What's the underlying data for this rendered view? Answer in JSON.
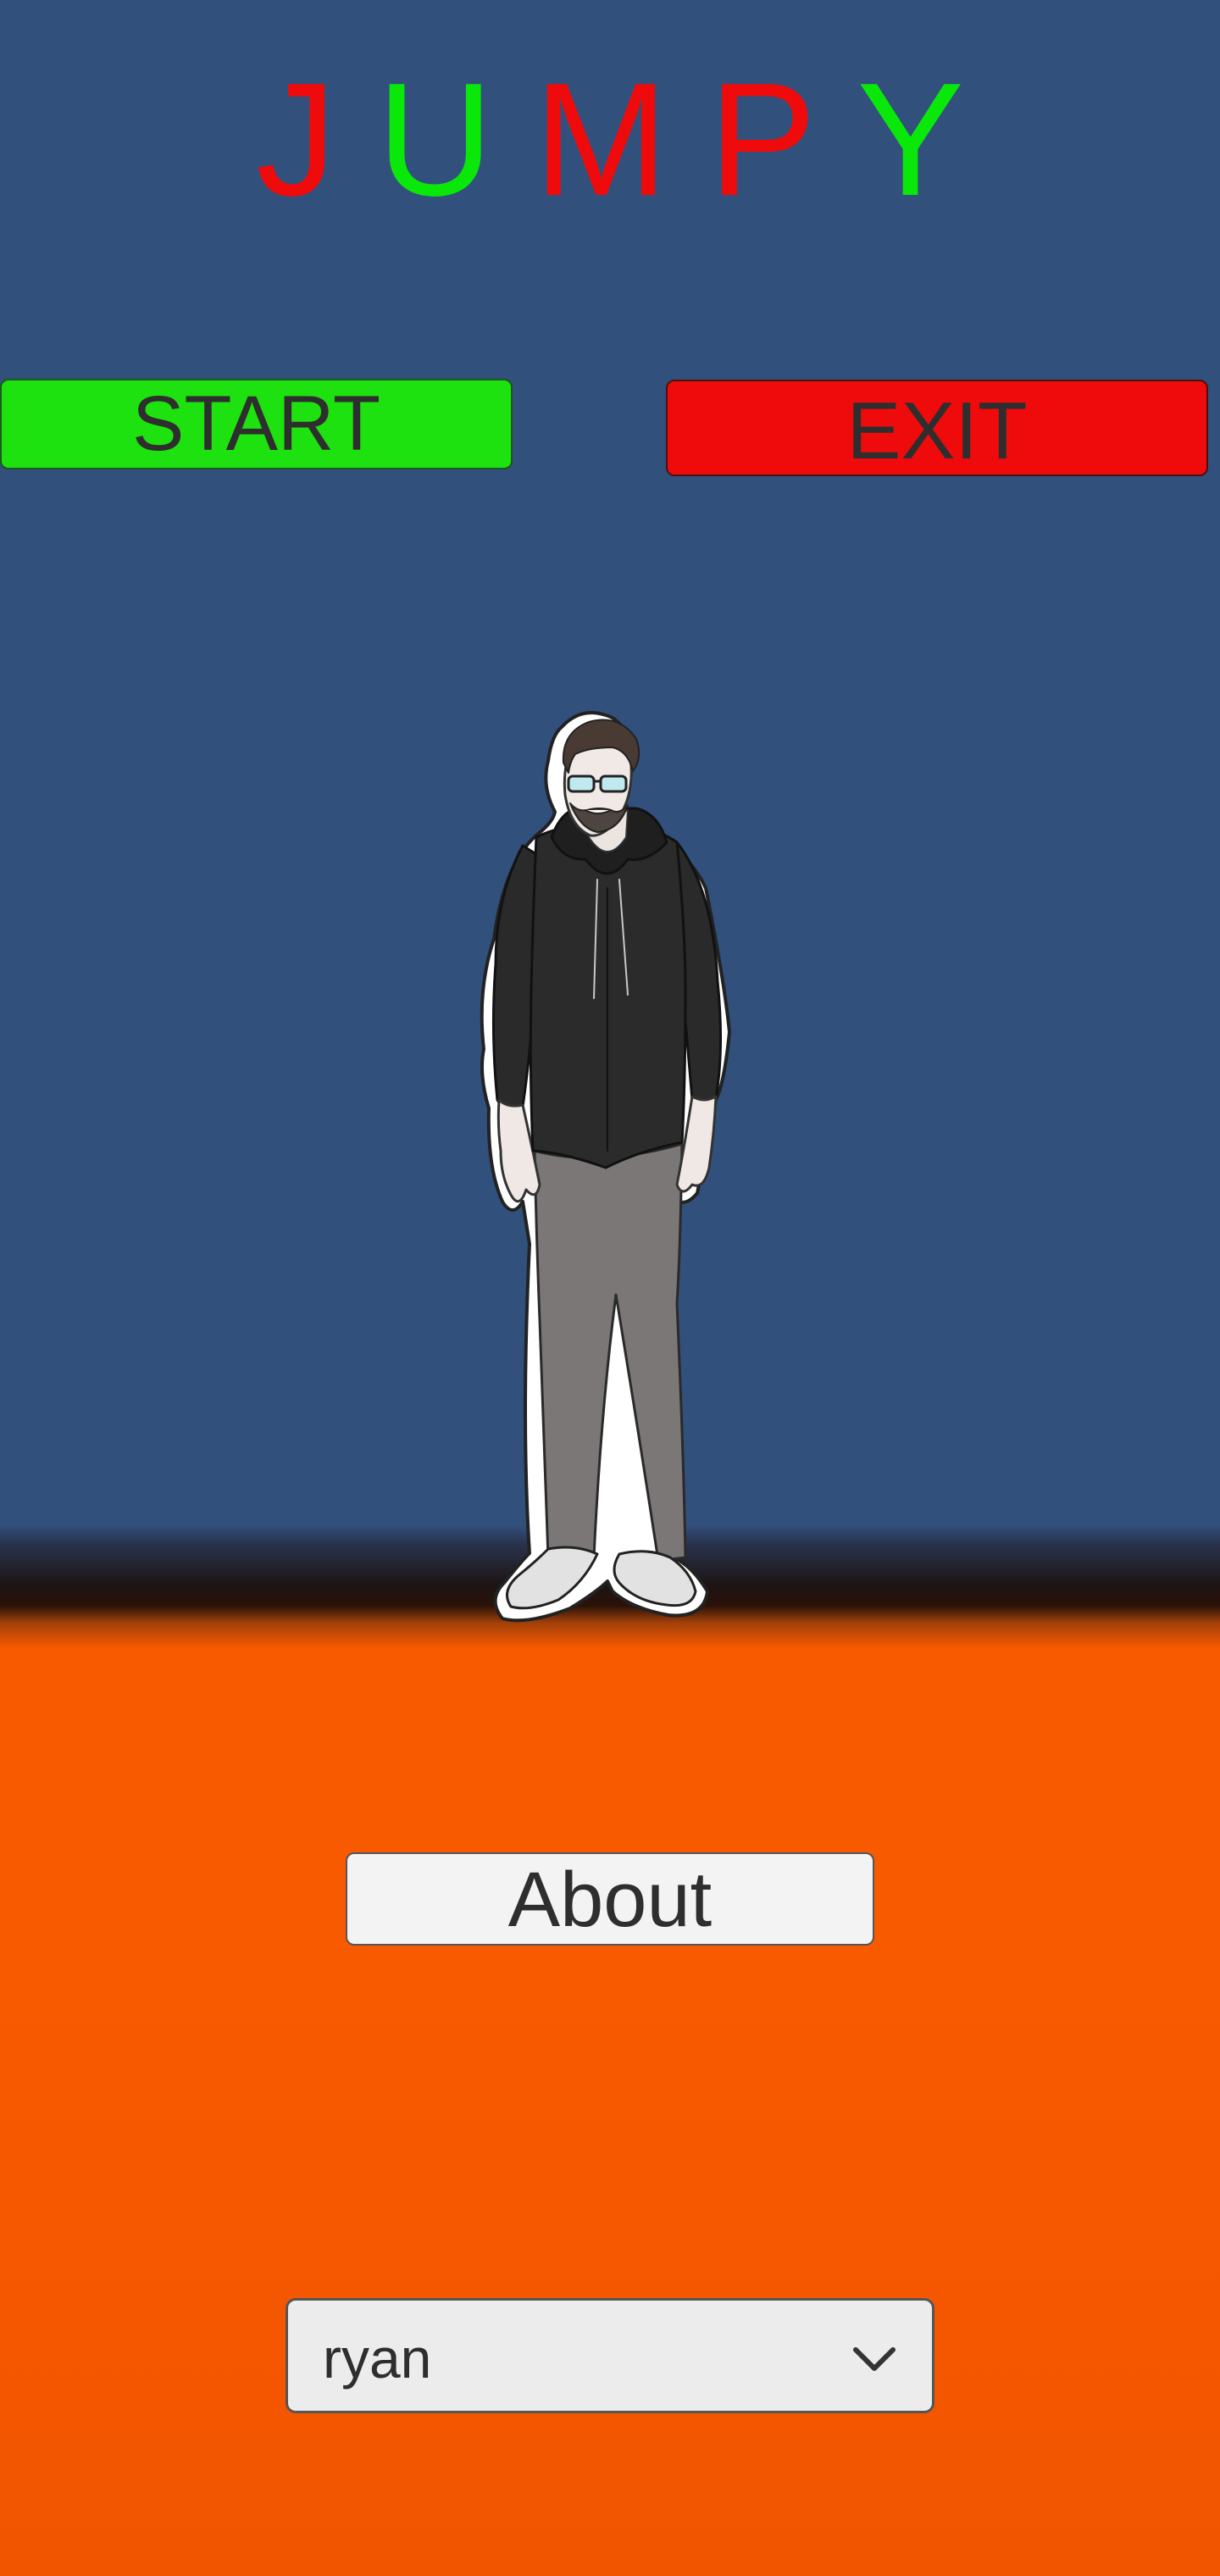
{
  "title": {
    "letters": [
      {
        "char": "J",
        "color": "#ef0b0c"
      },
      {
        "char": "U",
        "color": "#0ae80a"
      },
      {
        "char": "M",
        "color": "#ef0b0c"
      },
      {
        "char": "P",
        "color": "#ef0b0c"
      },
      {
        "char": "Y",
        "color": "#0ae80a"
      }
    ]
  },
  "buttons": {
    "start_label": "START",
    "exit_label": "EXIT",
    "about_label": "About"
  },
  "character_select": {
    "selected": "ryan",
    "icon": "chevron-down-icon"
  },
  "colors": {
    "sky": "#32507c",
    "ground": "#f85a00",
    "start": "#1ee20f",
    "exit": "#ef0b0c"
  }
}
